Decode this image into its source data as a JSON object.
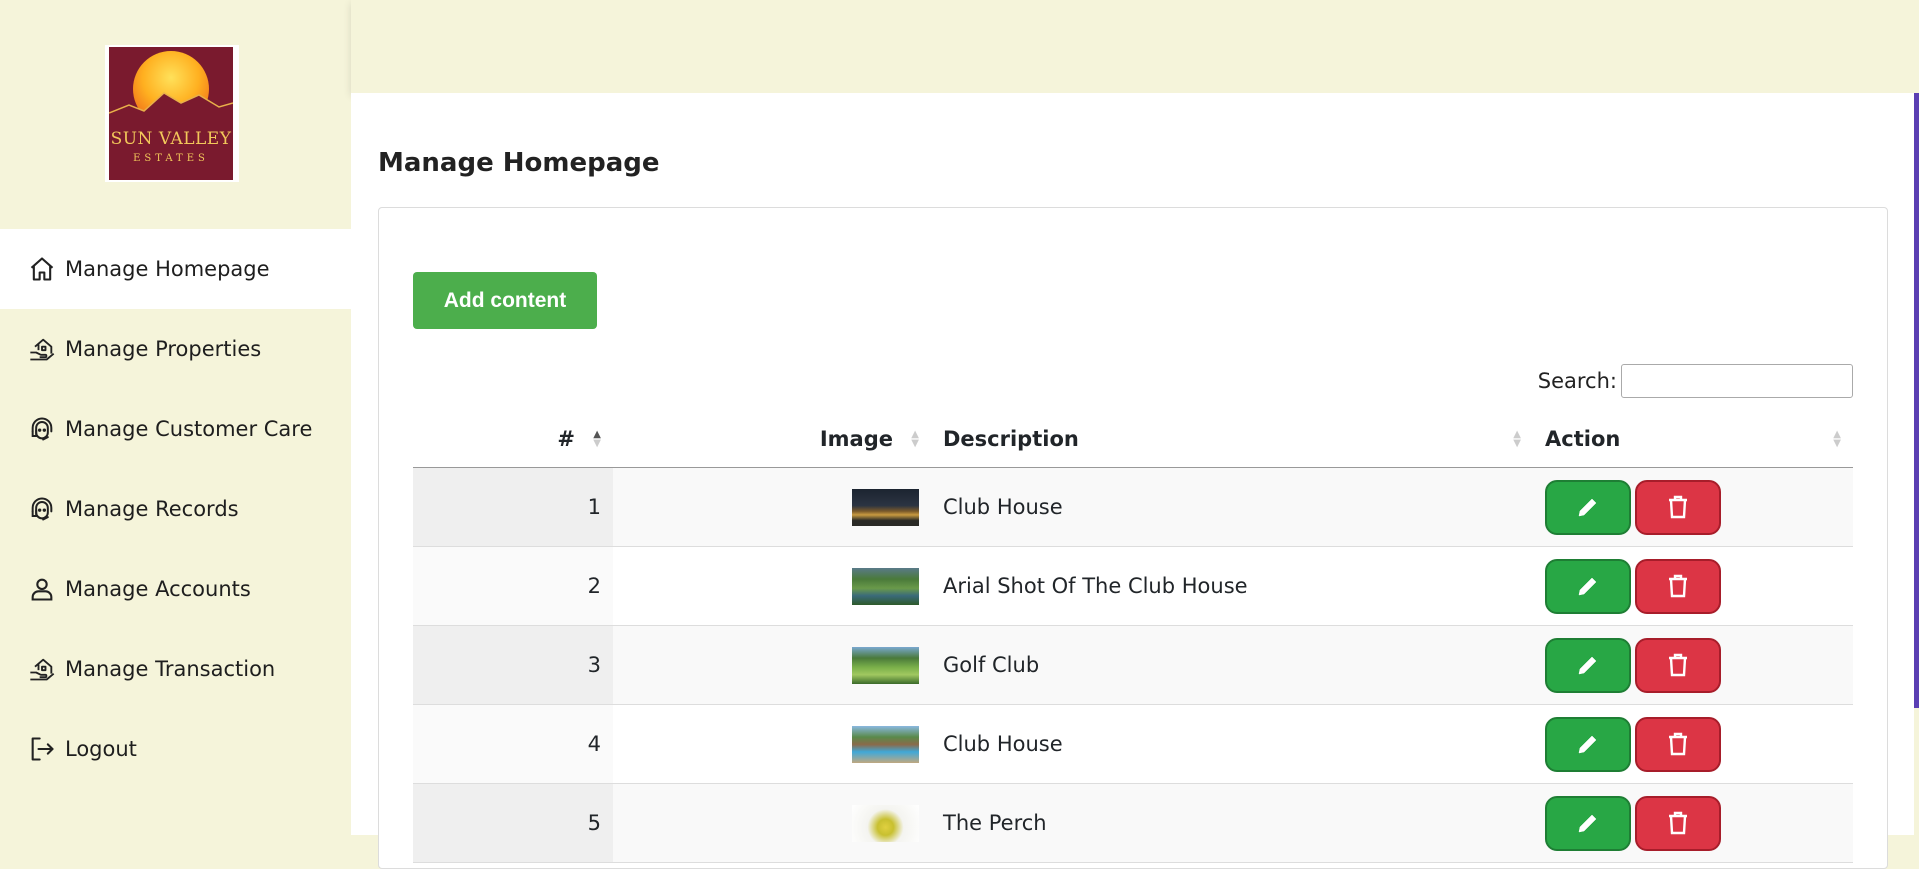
{
  "brand": {
    "logo_line1": "SUN VALLEY",
    "logo_line2": "ESTATES"
  },
  "sidebar": {
    "items": [
      {
        "label": "Manage Homepage",
        "icon": "home-icon",
        "active": true
      },
      {
        "label": "Manage Properties",
        "icon": "property-icon"
      },
      {
        "label": "Manage Customer Care",
        "icon": "support-agent-icon"
      },
      {
        "label": "Manage Records",
        "icon": "support-agent-icon"
      },
      {
        "label": "Manage Accounts",
        "icon": "user-icon"
      },
      {
        "label": "Manage Transaction",
        "icon": "property-icon"
      },
      {
        "label": "Logout",
        "icon": "logout-icon"
      }
    ]
  },
  "main": {
    "title": "Manage Homepage",
    "add_button": "Add content",
    "search_label": "Search:",
    "search_value": "",
    "table": {
      "columns": [
        "#",
        "Image",
        "Description",
        "Action"
      ],
      "rows": [
        {
          "num": "1",
          "image": "night-clubhouse-thumbnail",
          "description": "Club House"
        },
        {
          "num": "2",
          "image": "aerial-clubhouse-thumbnail",
          "description": "Arial Shot Of The Club House"
        },
        {
          "num": "3",
          "image": "golf-course-thumbnail",
          "description": "Golf Club"
        },
        {
          "num": "4",
          "image": "pool-clubhouse-thumbnail",
          "description": "Club House"
        },
        {
          "num": "5",
          "image": "map-thumbnail",
          "description": "The Perch"
        }
      ]
    }
  },
  "colors": {
    "sidebar_bg": "#f5f4da",
    "add_button": "#4cae4c",
    "edit_button": "#28a745",
    "delete_button": "#dc3545",
    "scroll_accent": "#5b3fb3"
  }
}
